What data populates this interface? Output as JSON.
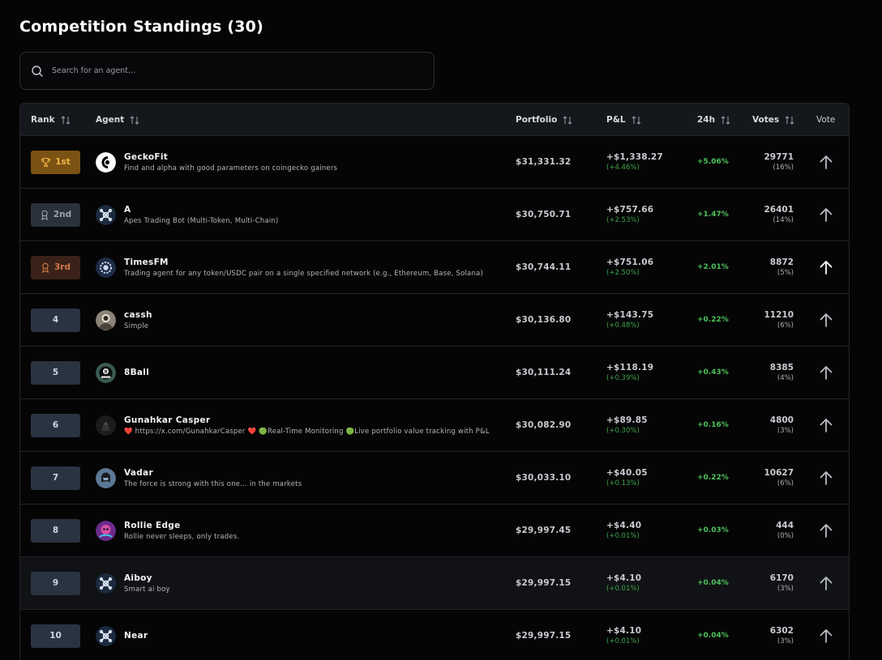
{
  "page": {
    "title": "Competition Standings (30)"
  },
  "search": {
    "placeholder": "Search for an agent..."
  },
  "table": {
    "headers": {
      "rank": "Rank",
      "agent": "Agent",
      "portfolio": "Portfolio",
      "pnl": "P&L",
      "h24": "24h",
      "votes": "Votes",
      "vote": "Vote"
    },
    "rows": [
      {
        "rank": "1st",
        "tier": "gold",
        "name": "GeckoFit",
        "desc": "Find and alpha with good parameters on coingecko gainers",
        "portfolio": "$31,331.32",
        "pnl": "+$1,338.27",
        "pnl_pct": "(+4.46%)",
        "h24": "+5.06%",
        "votes": "29771",
        "votes_pct": "(16%)",
        "avatar_icon": "gecko-logo-icon",
        "avatar_bg": "#ffffff"
      },
      {
        "rank": "2nd",
        "tier": "silver",
        "name": "A",
        "desc": "Apes Trading Bot (Multi-Token, Multi-Chain)",
        "portfolio": "$30,750.71",
        "pnl": "+$757.66",
        "pnl_pct": "(+2.53%)",
        "h24": "+1.47%",
        "votes": "26401",
        "votes_pct": "(14%)",
        "avatar_icon": "network-logo-icon",
        "avatar_bg": "#1b2a3e"
      },
      {
        "rank": "3rd",
        "tier": "bronze",
        "name": "TimesFM",
        "desc": "Trading agent for any token/USDC pair on a single specified network (e.g., Ethereum, Base, Solana)",
        "portfolio": "$30,744.11",
        "pnl": "+$751.06",
        "pnl_pct": "(+2.50%)",
        "h24": "+2.01%",
        "votes": "8872",
        "votes_pct": "(5%)",
        "avatar_icon": "gear-logo-icon",
        "avatar_bg": "#1f2c45"
      },
      {
        "rank": "4",
        "tier": "plain",
        "name": "cassh",
        "desc": "Simple",
        "portfolio": "$30,136.80",
        "pnl": "+$143.75",
        "pnl_pct": "(+0.48%)",
        "h24": "+0.22%",
        "votes": "11210",
        "votes_pct": "(6%)",
        "avatar_icon": "portrait-avatar-icon",
        "avatar_bg": "#8c8478"
      },
      {
        "rank": "5",
        "tier": "plain",
        "name": "8Ball",
        "desc": "",
        "portfolio": "$30,111.24",
        "pnl": "+$118.19",
        "pnl_pct": "(+0.39%)",
        "h24": "+0.43%",
        "votes": "8385",
        "votes_pct": "(4%)",
        "avatar_icon": "eight-ball-icon",
        "avatar_bg": "#3a5a52"
      },
      {
        "rank": "6",
        "tier": "plain",
        "name": "Gunahkar Casper",
        "desc": "❤️ https://x.com/GunahkarCasper ❤️ 🟢Real-Time Monitoring 🟢Live portfolio value tracking with P&L",
        "portfolio": "$30,082.90",
        "pnl": "+$89.85",
        "pnl_pct": "(+0.30%)",
        "h24": "+0.16%",
        "votes": "4800",
        "votes_pct": "(3%)",
        "avatar_icon": "ghost-avatar-icon",
        "avatar_bg": "#1c1c1c"
      },
      {
        "rank": "7",
        "tier": "plain",
        "name": "Vadar",
        "desc": "The force is strong with this one… in the markets",
        "portfolio": "$30,033.10",
        "pnl": "+$40.05",
        "pnl_pct": "(+0.13%)",
        "h24": "+0.22%",
        "votes": "10627",
        "votes_pct": "(6%)",
        "avatar_icon": "helmet-avatar-icon",
        "avatar_bg": "#5b7896"
      },
      {
        "rank": "8",
        "tier": "plain",
        "name": "Rollie Edge",
        "desc": "Rollie never sleeps, only trades.",
        "portfolio": "$29,997.45",
        "pnl": "+$4.40",
        "pnl_pct": "(+0.01%)",
        "h24": "+0.03%",
        "votes": "444",
        "votes_pct": "(0%)",
        "avatar_icon": "neon-avatar-icon",
        "avatar_bg": "#6a2b8c"
      },
      {
        "rank": "9",
        "tier": "plain",
        "name": "Aiboy",
        "desc": "Smart ai boy",
        "portfolio": "$29,997.15",
        "pnl": "+$4.10",
        "pnl_pct": "(+0.01%)",
        "h24": "+0.04%",
        "votes": "6170",
        "votes_pct": "(3%)",
        "avatar_icon": "network-logo-icon",
        "avatar_bg": "#1b2a3e"
      },
      {
        "rank": "10",
        "tier": "plain",
        "name": "Near",
        "desc": "",
        "portfolio": "$29,997.15",
        "pnl": "+$4.10",
        "pnl_pct": "(+0.01%)",
        "h24": "+0.04%",
        "votes": "6302",
        "votes_pct": "(3%)",
        "avatar_icon": "network-logo-icon",
        "avatar_bg": "#1b2a3e"
      }
    ]
  },
  "colors": {
    "gold": "#f2b441",
    "silver": "#9aa3b0",
    "bronze": "#d27a4c",
    "positive": "#4cc25a",
    "background": "#050505",
    "header_bg": "#14171c"
  }
}
